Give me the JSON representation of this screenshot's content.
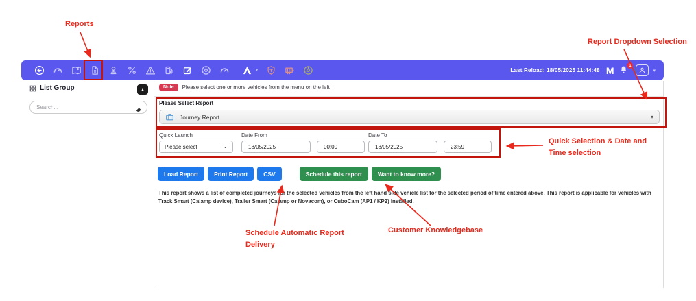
{
  "annotations": {
    "reports": "Reports",
    "report_dropdown": "Report Dropdown Selection",
    "quick_selection_line1": "Quick Selection & Date and",
    "quick_selection_line2": "Time selection",
    "schedule_line1": "Schedule Automatic Report",
    "schedule_line2": "Delivery",
    "knowledgebase": "Customer Knowledgebase"
  },
  "toolbar": {
    "last_reload": "Last Reload: 18/05/2025 11:44:48",
    "brand_logo": "M",
    "notification_count": "1",
    "icons": [
      "back-icon",
      "dashboard-gauge-icon",
      "map-route-icon",
      "reports-icon",
      "location-pin-icon",
      "percent-icon",
      "warning-triangle-icon",
      "fuel-pump-icon",
      "edit-icon",
      "steering-wheel-icon",
      "speedometer-icon",
      "brand-a-icon",
      "shield-icon",
      "trailer-icon",
      "wheel-olive-icon",
      "bell-icon",
      "user-icon"
    ]
  },
  "sidebar": {
    "title": "List Group",
    "search_placeholder": "Search..."
  },
  "main": {
    "note": {
      "badge": "Note",
      "text": "Please select one or more vehicles from the menu on the left"
    },
    "report_select": {
      "label": "Please Select Report",
      "value": "Journey Report"
    },
    "quick_launch": {
      "label": "Quick Launch",
      "value": "Please select",
      "date_from_label": "Date From",
      "date_from_value": "18/05/2025",
      "time_from_value": "00:00",
      "date_to_label": "Date To",
      "date_to_value": "18/05/2025",
      "time_to_value": "23:59"
    },
    "buttons": {
      "load": "Load Report",
      "print": "Print Report",
      "csv": "CSV",
      "schedule": "Schedule this report",
      "know_more": "Want to know more?"
    },
    "description": "This report shows a list of completed journeys for the selected vehicles from the left hand side vehicle list for the selected period of time entered above. This report is applicable for vehicles with Track Smart (Calamp device), Trailer Smart (Calamp or Novacom), or CuboCam (AP1 / KP2) installed."
  },
  "colors": {
    "toolbar_bg": "#5a57ee",
    "note_badge": "#d53a52",
    "button_blue": "#1d79ec",
    "button_green": "#2f8f4f",
    "annotation_red": "#e8291c",
    "annotation_box_red": "#c1150e",
    "icon_lavender": "#c9c7f8",
    "icon_red": "#d98f8f",
    "icon_olive": "#aaa96e",
    "journey_icon_blue": "#5c9bd1",
    "notification_badge": "#e0304a"
  }
}
